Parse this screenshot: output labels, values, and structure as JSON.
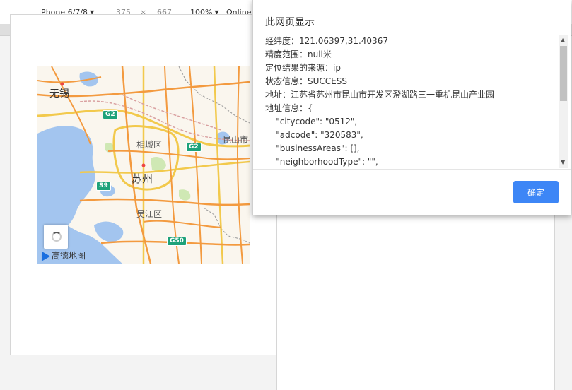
{
  "toolbar": {
    "device": "iPhone 6/7/8",
    "width": "375",
    "times": "×",
    "height": "667",
    "zoom": "100%",
    "network": "Online"
  },
  "map": {
    "labels": {
      "wuxi": "无锡",
      "xiangcheng": "相城区",
      "suzhou": "苏州",
      "wujiang": "吴江区",
      "kunshan": "昆山市"
    },
    "shields": {
      "g2a": "G2",
      "g2b": "G2",
      "s9": "S9",
      "g50": "G50"
    },
    "logo_text": "高德地图"
  },
  "dialog": {
    "title": "此网页显示",
    "lines": [
      "经纬度：121.06397,31.40367",
      "精度范围：null米",
      "定位结果的来源：ip",
      "状态信息：SUCCESS",
      "地址：江苏省苏州市昆山市开发区澄湖路三一重机昆山产业园",
      "地址信息：{",
      "    \"citycode\": \"0512\",",
      "    \"adcode\": \"320583\",",
      "    \"businessAreas\": [],",
      "    \"neighborhoodType\": \"\","
    ],
    "ok_label": "确定"
  },
  "colors": {
    "accent": "#3d86f6",
    "water": "#a3c5ef",
    "road": "#f39a3f",
    "highway": "#f2c94c"
  }
}
